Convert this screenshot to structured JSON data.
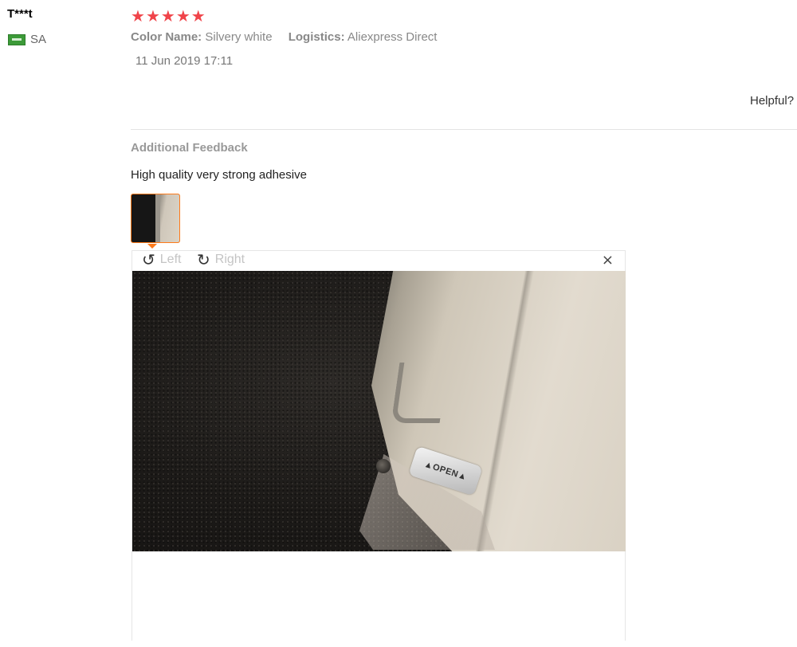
{
  "review": {
    "user_name": "T***t",
    "country_code": "SA",
    "rating_stars": 5,
    "attributes": [
      {
        "key": "Color Name:",
        "value": "Silvery white"
      },
      {
        "key": "Logistics:",
        "value": "Aliexpress Direct"
      }
    ],
    "date": "11 Jun 2019 17:11",
    "helpful_label": "Helpful?"
  },
  "feedback": {
    "title": "Additional Feedback",
    "text": "High quality very strong adhesive"
  },
  "viewer": {
    "rotate_left_label": "Left",
    "rotate_right_label": "Right",
    "close_icon": "×",
    "photo_sticker_text": "▲OPEN▲"
  },
  "icons": {
    "star": "★",
    "rotate_left": "↺",
    "rotate_right": "↻"
  },
  "colors": {
    "star": "#f0444a",
    "thumb_border": "#ff7a1a"
  }
}
